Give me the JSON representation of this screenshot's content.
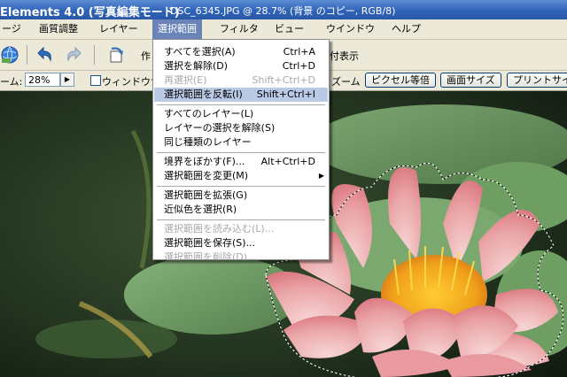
{
  "window": {
    "app_title": "Elements 4.0 (写真編集モード)",
    "doc_title": "DSC_6345.JPG @ 28.7% (背景 のコピー, RGB/8)"
  },
  "menubar": {
    "items": [
      {
        "label": "ージ",
        "active": false
      },
      {
        "label": "画質調整",
        "active": false
      },
      {
        "label": "レイヤー",
        "active": false
      },
      {
        "label": "選択範囲",
        "active": true
      },
      {
        "label": "フィルタ",
        "active": false
      },
      {
        "label": "ビュー",
        "active": false
      },
      {
        "label": "ウインドウ",
        "active": false
      },
      {
        "label": "ヘルプ",
        "active": false
      }
    ]
  },
  "toolbar": {
    "create_label": "作",
    "display_label": "付表示"
  },
  "options": {
    "zoom_label": "ーム:",
    "zoom_value": "28%",
    "window_size_label": "ウィンドウサイ",
    "zoom_word": "ズーム",
    "btn_actual_pixels": "ピクセル等倍",
    "btn_fit_screen": "画面サイズ",
    "btn_print_size": "プリントサイズ"
  },
  "dropdown": {
    "items": [
      {
        "label": "すべてを選択(A)",
        "shortcut": "Ctrl+A",
        "disabled": false,
        "highlighted": false
      },
      {
        "label": "選択を解除(D)",
        "shortcut": "Ctrl+D",
        "disabled": false,
        "highlighted": false
      },
      {
        "label": "再選択(E)",
        "shortcut": "Shift+Ctrl+D",
        "disabled": true,
        "highlighted": false
      },
      {
        "label": "選択範囲を反転(I)",
        "shortcut": "Shift+Ctrl+I",
        "disabled": false,
        "highlighted": true
      },
      {
        "separator": true
      },
      {
        "label": "すべてのレイヤー(L)",
        "shortcut": "",
        "disabled": false,
        "highlighted": false
      },
      {
        "label": "レイヤーの選択を解除(S)",
        "shortcut": "",
        "disabled": false,
        "highlighted": false
      },
      {
        "label": "同じ種類のレイヤー",
        "shortcut": "",
        "disabled": false,
        "highlighted": false
      },
      {
        "separator": true
      },
      {
        "label": "境界をぼかす(F)...",
        "shortcut": "Alt+Ctrl+D",
        "disabled": false,
        "highlighted": false
      },
      {
        "label": "選択範囲を変更(M)",
        "shortcut": "",
        "disabled": false,
        "highlighted": false,
        "submenu": true
      },
      {
        "separator": true
      },
      {
        "label": "選択範囲を拡張(G)",
        "shortcut": "",
        "disabled": false,
        "highlighted": false
      },
      {
        "label": "近似色を選択(R)",
        "shortcut": "",
        "disabled": false,
        "highlighted": false
      },
      {
        "separator": true
      },
      {
        "label": "選択範囲を読み込む(L)...",
        "shortcut": "",
        "disabled": true,
        "highlighted": false
      },
      {
        "label": "選択範囲を保存(S)...",
        "shortcut": "",
        "disabled": false,
        "highlighted": false
      },
      {
        "label": "選択範囲を削除(D)...",
        "shortcut": "",
        "disabled": true,
        "highlighted": false
      }
    ]
  },
  "icons": {
    "globe": "globe-icon",
    "undo": "undo-icon",
    "redo": "redo-icon",
    "rotate": "rotate-icon",
    "submenu_arrow": "chevron-right-icon"
  },
  "colors": {
    "titlebar": "#2f63b8",
    "menu_active": "#6b84b8",
    "menu_highlight": "#b9c9e6",
    "chrome": "#ece9d8"
  }
}
